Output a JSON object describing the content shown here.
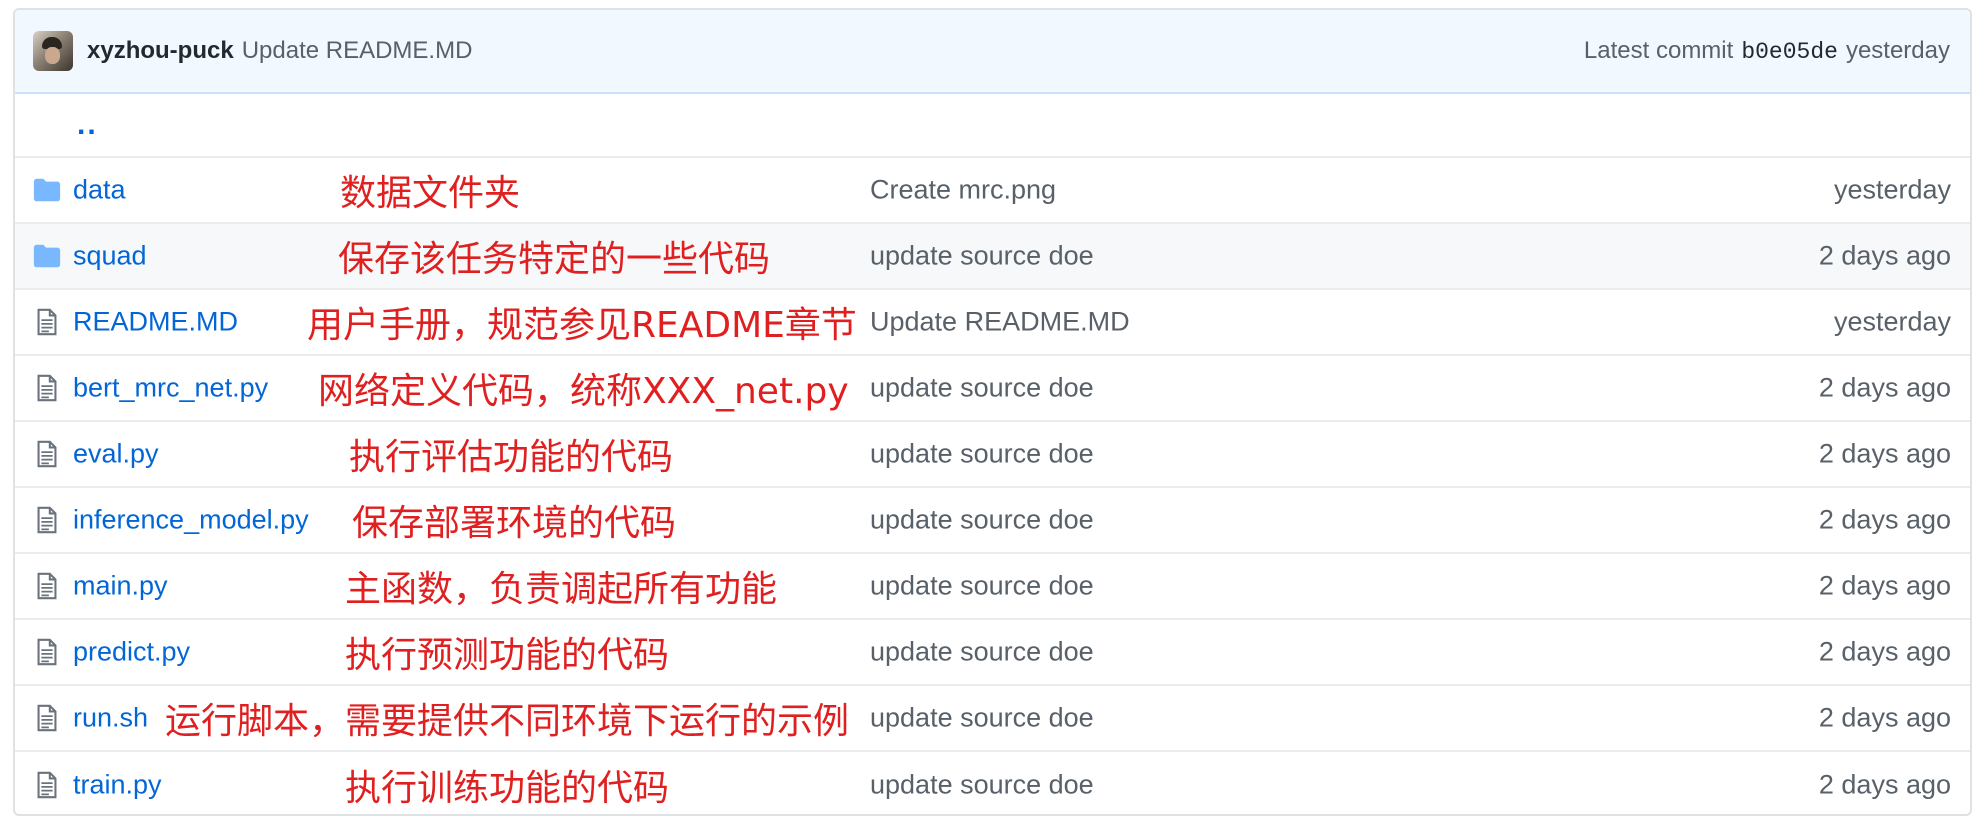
{
  "commit": {
    "author": "xyzhou-puck",
    "message": "Update README.MD",
    "latest_label": "Latest commit",
    "sha": "b0e05de",
    "age": "yesterday"
  },
  "parent_link": "..",
  "files": [
    {
      "type": "folder",
      "name": "data",
      "annotation": "数据文件夹",
      "message": "Create mrc.png",
      "age": "yesterday"
    },
    {
      "type": "folder",
      "name": "squad",
      "annotation": "保存该任务特定的一些代码",
      "message": "update source doe",
      "age": "2 days ago"
    },
    {
      "type": "file",
      "name": "README.MD",
      "annotation": "用户手册，规范参见README章节",
      "message": "Update README.MD",
      "age": "yesterday"
    },
    {
      "type": "file",
      "name": "bert_mrc_net.py",
      "annotation": "网络定义代码，统称XXX_net.py",
      "message": "update source doe",
      "age": "2 days ago"
    },
    {
      "type": "file",
      "name": "eval.py",
      "annotation": "执行评估功能的代码",
      "message": "update source doe",
      "age": "2 days ago"
    },
    {
      "type": "file",
      "name": "inference_model.py",
      "annotation": "保存部署环境的代码",
      "message": "update source doe",
      "age": "2 days ago"
    },
    {
      "type": "file",
      "name": "main.py",
      "annotation": "主函数，负责调起所有功能",
      "message": "update source doe",
      "age": "2 days ago"
    },
    {
      "type": "file",
      "name": "predict.py",
      "annotation": "执行预测功能的代码",
      "message": "update source doe",
      "age": "2 days ago"
    },
    {
      "type": "file",
      "name": "run.sh",
      "annotation": "运行脚本，需要提供不同环境下运行的示例",
      "message": "update source doe",
      "age": "2 days ago"
    },
    {
      "type": "file",
      "name": "train.py",
      "annotation": "执行训练功能的代码",
      "message": "update source doe",
      "age": "2 days ago"
    }
  ],
  "colors": {
    "link": "#0366d6",
    "annotation": "#e02020",
    "header_bg": "#f1f8ff",
    "muted_text": "#586069",
    "folder_icon": "#79b8ff",
    "file_icon": "#6a737d"
  }
}
